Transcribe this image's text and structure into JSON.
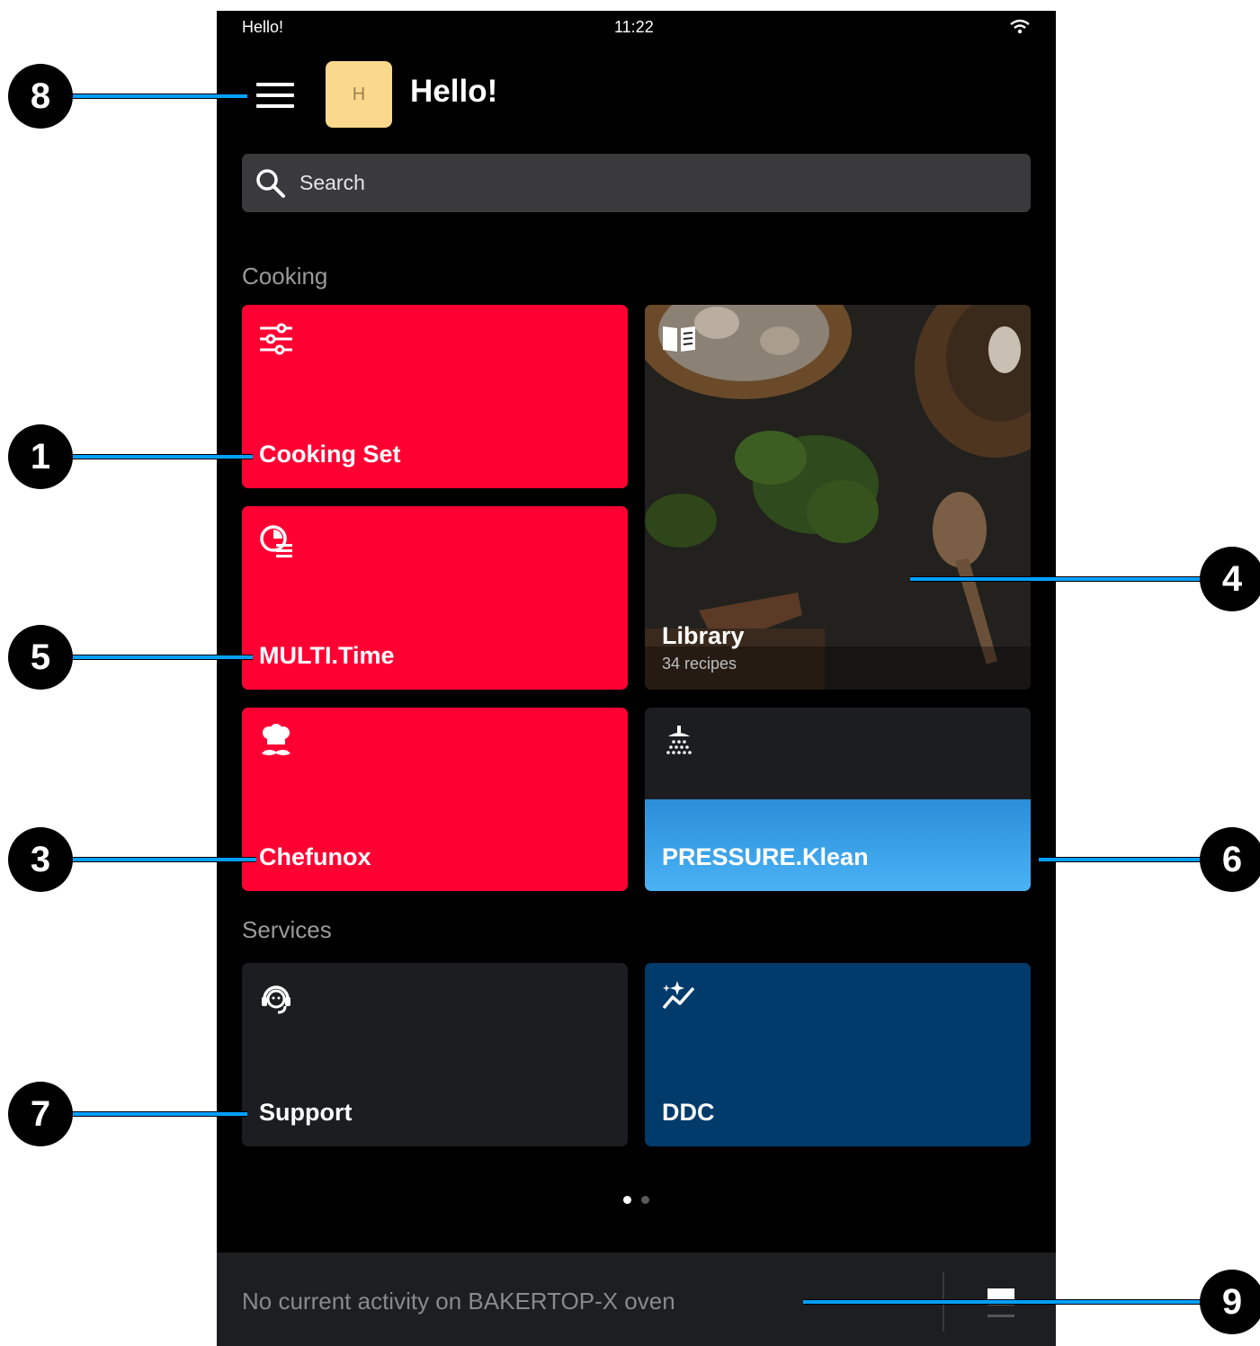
{
  "status_bar": {
    "left_text": "Hello!",
    "time": "11:22",
    "wifi_icon": "wifi-icon"
  },
  "header": {
    "menu_icon": "menu-icon",
    "avatar_initial": "H",
    "greeting": "Hello!"
  },
  "search": {
    "placeholder": "Search",
    "icon": "search-icon"
  },
  "sections": {
    "cooking": "Cooking",
    "services": "Services"
  },
  "tiles": {
    "cooking_set": {
      "label": "Cooking Set",
      "icon": "sliders-icon",
      "color": "#ff0033"
    },
    "multi_time": {
      "label": "MULTI.Time",
      "icon": "timer-list-icon",
      "color": "#ff0033"
    },
    "chefunox": {
      "label": "Chefunox",
      "icon": "chef-icon",
      "color": "#ff0033"
    },
    "library": {
      "label": "Library",
      "sub": "34 recipes",
      "icon": "book-icon"
    },
    "pressure_klean": {
      "label": "PRESSURE.Klean",
      "icon": "shower-icon",
      "color": "#3aa3ee"
    },
    "support": {
      "label": "Support",
      "icon": "headset-icon",
      "color": "#1c1d20"
    },
    "ddc": {
      "label": "DDC",
      "icon": "sparkle-chart-icon",
      "color": "#003b6b"
    }
  },
  "pager": {
    "active_page": 1,
    "total_pages": 2
  },
  "bottom_bar": {
    "activity": "No current activity on BAKERTOP-X oven",
    "icon": "oven-icon"
  },
  "callouts": {
    "c1": "1",
    "c3": "3",
    "c4": "4",
    "c5": "5",
    "c6": "6",
    "c7": "7",
    "c8": "8",
    "c9": "9"
  },
  "colors": {
    "accent_red": "#ff0033",
    "callout_line": "#00a0ff",
    "background": "#000000"
  }
}
